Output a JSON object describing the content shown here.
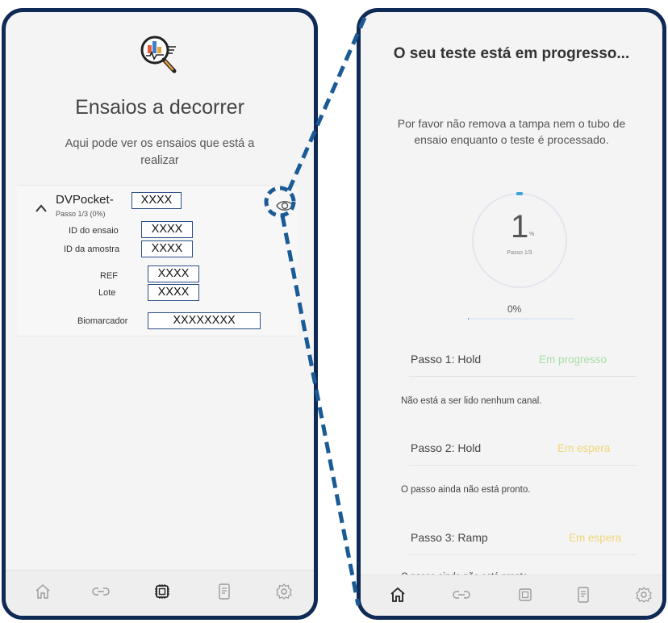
{
  "left_screen": {
    "title": "Ensaios a decorrer",
    "subtitle": "Aqui pode ver os ensaios que está a realizar",
    "assay": {
      "device_prefix": "DVPocket-",
      "device_id": "XXXX",
      "step_text": "Passo 1/3 (0%)",
      "fields": [
        {
          "label": "ID do ensaio",
          "value": "XXXX"
        },
        {
          "label": "ID da amostra",
          "value": "XXXX"
        },
        {
          "label": "REF",
          "value": "XXXX"
        },
        {
          "label": "Lote",
          "value": "XXXX"
        },
        {
          "label": "Biomarcador",
          "value": "XXXXXXXX"
        }
      ]
    },
    "nav": [
      "home-icon",
      "link-icon",
      "chip-icon",
      "document-icon",
      "settings-icon"
    ],
    "active_nav": "chip-icon"
  },
  "right_screen": {
    "title": "O seu teste está em progresso...",
    "subtitle": "Por favor não remova a tampa nem o tubo de ensaio enquanto o teste é processado.",
    "progress_value": "1",
    "progress_unit": "%",
    "progress_step": "Passo 1/3",
    "progress_percent_label": "0%",
    "progress_fraction": 0.01,
    "steps": [
      {
        "name": "Passo 1: Hold",
        "status": "Em progresso",
        "status_color": "#a6e0a6",
        "note": "Não está a ser lido nenhum canal."
      },
      {
        "name": "Passo 2: Hold",
        "status": "Em espera",
        "status_color": "#f0d67a",
        "note": "O passo ainda não está pronto."
      },
      {
        "name": "Passo 3: Ramp",
        "status": "Em espera",
        "status_color": "#f0d67a",
        "note": "O passo ainda não está pronto."
      }
    ],
    "nav": [
      "home-icon",
      "link-icon",
      "chip-icon",
      "document-icon",
      "settings-icon"
    ],
    "active_nav": "home-icon"
  },
  "colors": {
    "frame": "#0f2a55",
    "connector": "#1a5b96",
    "field_border": "#2b4f86",
    "progress_accent": "#3ea4d8"
  }
}
